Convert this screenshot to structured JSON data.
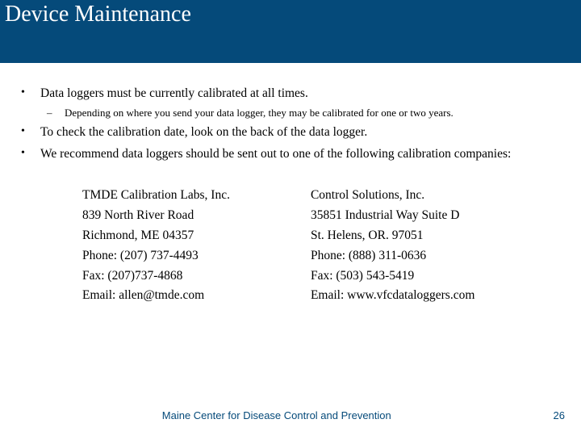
{
  "title": "Device Maintenance",
  "bullets": {
    "b1": "Data loggers must be currently calibrated at all times.",
    "b1_sub": "Depending on where you send your data logger, they may be calibrated for one or two years.",
    "b2": "To check the calibration date, look on the back of the data logger.",
    "b3": "We recommend data loggers should be sent out to one of the following calibration companies:"
  },
  "companies": {
    "left": {
      "name": "TMDE Calibration Labs, Inc.",
      "addr1": "839 North River Road",
      "addr2": "Richmond, ME 04357",
      "phone": "Phone: (207) 737-4493",
      "fax": "Fax: (207)737-4868",
      "email": "Email: allen@tmde.com"
    },
    "right": {
      "name": "Control Solutions, Inc.",
      "addr1": "35851 Industrial Way Suite D",
      "addr2": "St. Helens, OR. 97051",
      "phone": "Phone: (888) 311-0636",
      "fax": "Fax: (503) 543-5419",
      "email": "Email: www.vfcdataloggers.com"
    }
  },
  "footer": {
    "org": "Maine Center for Disease Control and Prevention",
    "page": "26"
  }
}
